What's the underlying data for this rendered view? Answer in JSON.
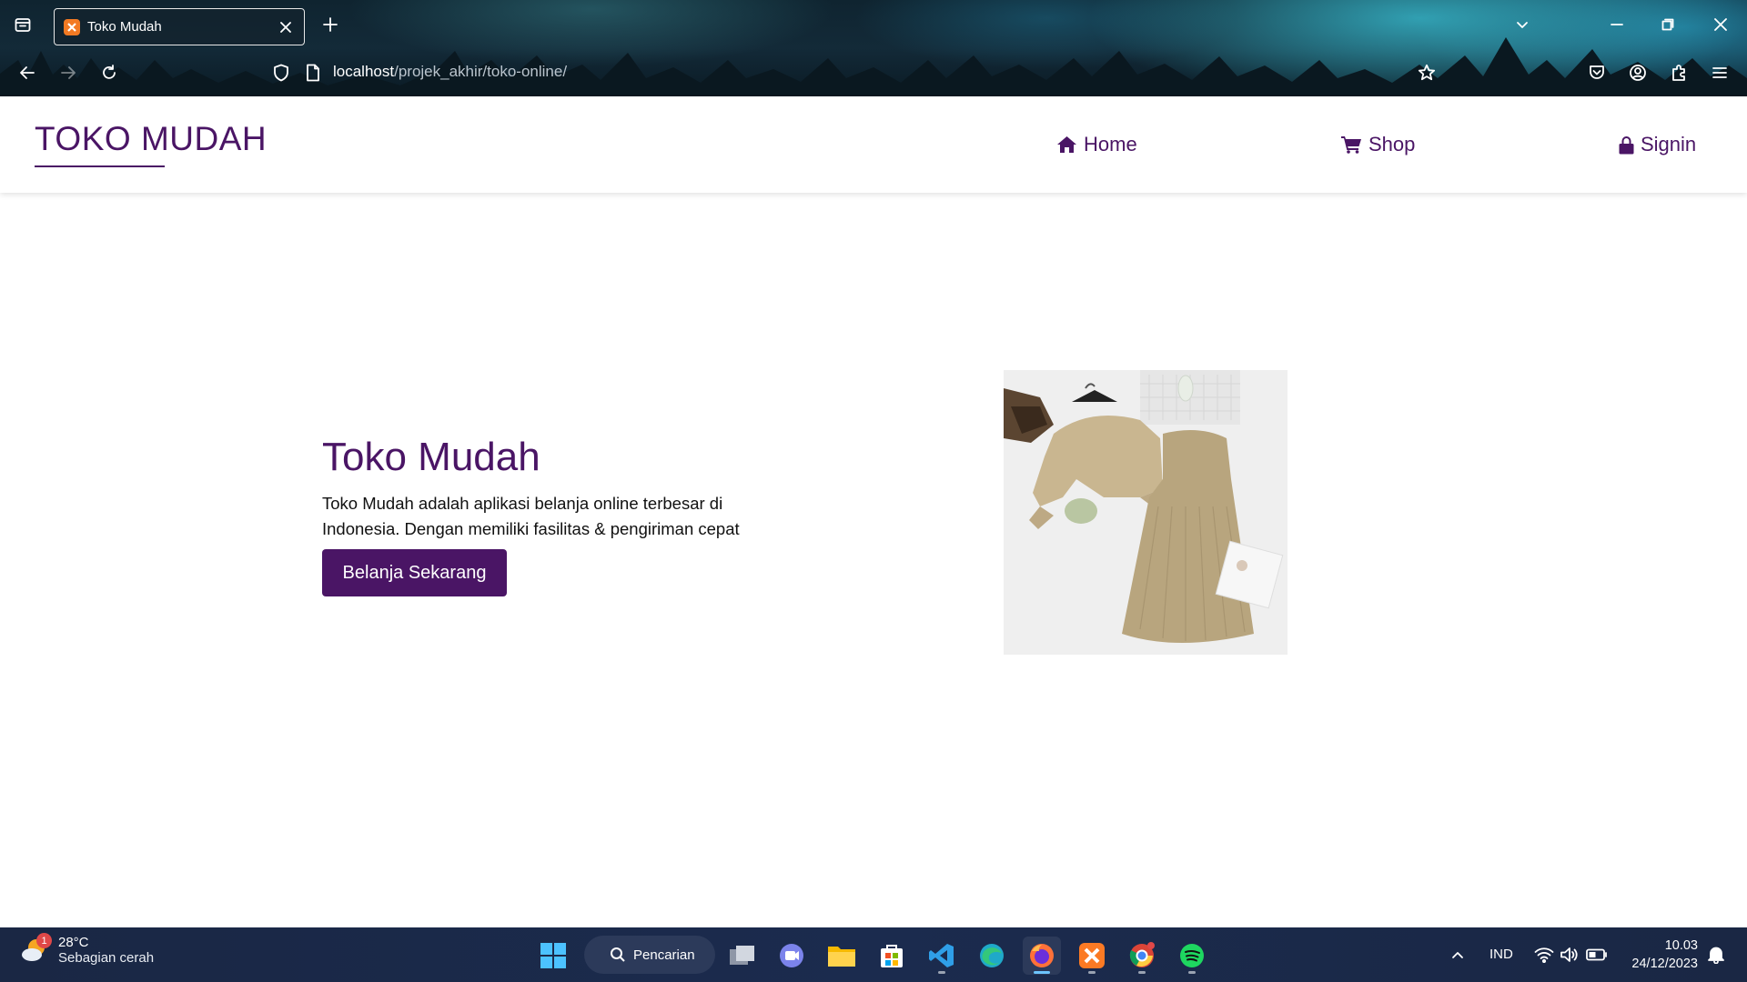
{
  "browser": {
    "tab_title": "Toko Mudah",
    "url_host": "localhost",
    "url_path": "/projek_akhir/toko-online/"
  },
  "site": {
    "logo": "TOKO MUDAH",
    "nav": {
      "home": "Home",
      "shop": "Shop",
      "signin": "Signin"
    }
  },
  "hero": {
    "title": "Toko Mudah",
    "description": "Toko Mudah adalah aplikasi belanja online terbesar di Indonesia. Dengan memiliki fasilitas & pengiriman cepat",
    "button": "Belanja Sekarang"
  },
  "taskbar": {
    "weather_badge": "1",
    "weather_temp": "28°C",
    "weather_desc": "Sebagian cerah",
    "search_label": "Pencarian",
    "language": "IND",
    "time": "10.03",
    "date": "24/12/2023"
  },
  "colors": {
    "brand": "#4a1565",
    "taskbar": "#1a2744"
  }
}
